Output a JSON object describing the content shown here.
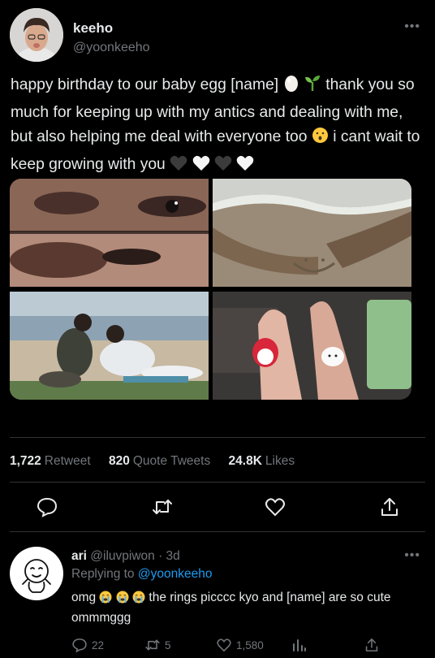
{
  "tweet": {
    "display_name": "keeho",
    "handle": "@yoonkeeho",
    "more": "•••",
    "text_part1": "happy birthday to our baby egg [name] ",
    "text_part2": " thank you so much for keeping up with my antics and dealing with me, but also helping me deal with everyone too ",
    "text_part3": " i cant wait to keep growing with you ",
    "icons": [
      "egg-emoji",
      "seedling-emoji",
      "hushed-face-emoji",
      "black-heart-emoji",
      "white-heart-emoji",
      "black-heart-emoji",
      "white-heart-emoji"
    ]
  },
  "stats": [
    {
      "value": "1,722",
      "label": "Retweet"
    },
    {
      "value": "820",
      "label": "Quote Tweets"
    },
    {
      "value": "24.8K",
      "label": "Likes"
    }
  ],
  "actions": [
    "reply-icon",
    "retweet-icon",
    "like-icon",
    "share-icon"
  ],
  "reply": {
    "name": "ari",
    "handle": "@iluvpiwon",
    "time": "· 3d",
    "more": "•••",
    "replying_prefix": "Replying to",
    "replying_to": "@yoonkeeho",
    "text_a": "omg ",
    "text_b": " the rings picccc kyo and [name] are so cute ommmggg",
    "icons": [
      "loudly-crying-emoji",
      "loudly-crying-emoji",
      "loudly-crying-emoji"
    ],
    "counts": {
      "replies": "22",
      "retweets": "5",
      "likes": "1,580",
      "views": ""
    }
  },
  "colors": {
    "background": "#000000",
    "text": "#e7e9ea",
    "muted": "#71767b",
    "link": "#1d9bf0",
    "divider": "#2f3336"
  }
}
